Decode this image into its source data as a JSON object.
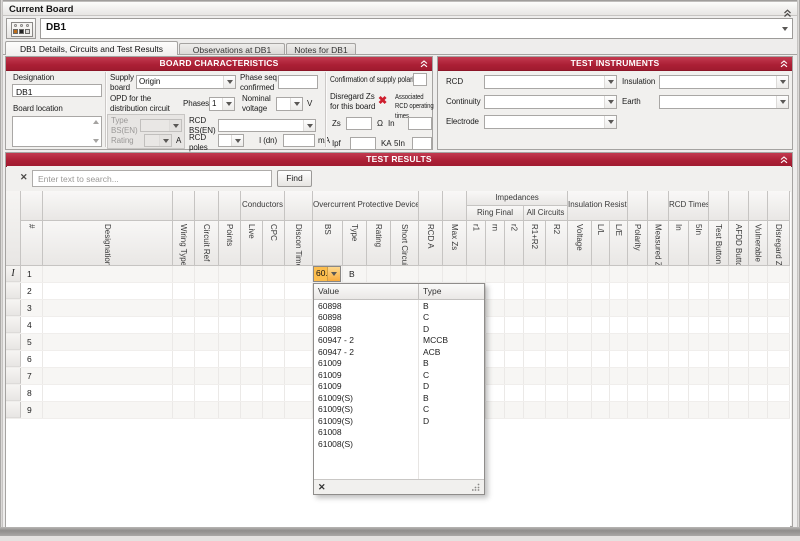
{
  "window": {
    "title": "Current Board",
    "board_value": "DB1"
  },
  "tabs": [
    "DB1 Details, Circuits and Test Results",
    "Observations at DB1",
    "Notes for DB1"
  ],
  "colors": {
    "header_red": "#ab1f35",
    "editor_highlight": "#fcbd4d"
  },
  "bc": {
    "title": "BOARD CHARACTERISTICS",
    "designation_label": "Designation",
    "designation_value": "DB1",
    "location_label": "Board location",
    "supply_label": "Supply board",
    "supply_value": "Origin",
    "phase_seq_label": "Phase seq confirmed",
    "opd_label": "OPD for the distribution circuit",
    "phases_label": "Phases",
    "phases_value": "1",
    "nominal_label": "Nominal voltage",
    "volt_unit": "V",
    "type_label": "Type BS(EN)",
    "rcd_bs_label": "RCD BS(EN)",
    "rating_label": "Rating",
    "amp_unit": "A",
    "poles_label": "RCD poles",
    "idn_label": "I (dn)",
    "ma_unit": "mA",
    "confirm_label": "Confirmation of supply polarity",
    "disregard_label": "Disregard Zs for this board",
    "assoc_label": "Associated RCD operating times",
    "zs_label": "Zs",
    "ohm_unit": "Ω",
    "in_label": "In",
    "ipf_label": "Ipf",
    "ka_unit": "KA",
    "in5_label": "5In"
  },
  "ti": {
    "title": "TEST INSTRUMENTS",
    "rcd": "RCD",
    "insulation": "Insulation",
    "continuity": "Continuity",
    "earth": "Earth",
    "electrode": "Electrode"
  },
  "tr": {
    "title": "TEST RESULTS",
    "search_placeholder": "Enter text to search...",
    "find": "Find",
    "grid": {
      "units": [
        {
          "cols": [
            "#"
          ]
        },
        {
          "cols": [
            "Designation"
          ]
        },
        {
          "cols": [
            "Wiring Type"
          ]
        },
        {
          "cols": [
            "Circuit Ref"
          ]
        },
        {
          "cols": [
            "Points"
          ]
        },
        {
          "group": "Conductors",
          "cols": [
            "Live",
            "CPC"
          ]
        },
        {
          "cols": [
            "Discon Time"
          ]
        },
        {
          "group": "Overcurrent Protective Device",
          "cols": [
            "BS",
            "Type",
            "Rating",
            "Short Circuit"
          ]
        },
        {
          "cols": [
            "RCD A"
          ]
        },
        {
          "cols": [
            "Max Zs"
          ]
        },
        {
          "group": "Impedances",
          "subs": [
            {
              "label": "Ring Final",
              "cols": [
                "r1",
                "rn",
                "r2"
              ]
            },
            {
              "label": "All Circuits",
              "cols": [
                "R1+R2",
                "R2"
              ]
            }
          ]
        },
        {
          "group": "Insulation Resistance",
          "cols": [
            "Voltage",
            "L/L",
            "L/E"
          ]
        },
        {
          "cols": [
            "Polarity"
          ]
        },
        {
          "cols": [
            "Measured Zs"
          ]
        },
        {
          "group": "RCD Times",
          "cols": [
            "In",
            "5In"
          ]
        },
        {
          "cols": [
            "Test Button"
          ]
        },
        {
          "cols": [
            "AFDD Button"
          ]
        },
        {
          "cols": [
            "Vulnerable"
          ]
        },
        {
          "cols": [
            "Disregard Zs"
          ]
        }
      ],
      "row_numbers": [
        "1",
        "2",
        "3",
        "4",
        "5",
        "6",
        "7",
        "8",
        "9"
      ],
      "editor": {
        "value": "60...",
        "type": "B"
      }
    }
  },
  "popup": {
    "headers": [
      "Value",
      "Type"
    ],
    "items": [
      {
        "value": "60898",
        "type": "B"
      },
      {
        "value": "60898",
        "type": "C"
      },
      {
        "value": "60898",
        "type": "D"
      },
      {
        "value": "60947 - 2",
        "type": "MCCB"
      },
      {
        "value": "60947 - 2",
        "type": "ACB"
      },
      {
        "value": "61009",
        "type": "B"
      },
      {
        "value": "61009",
        "type": "C"
      },
      {
        "value": "61009",
        "type": "D"
      },
      {
        "value": "61009(S)",
        "type": "B"
      },
      {
        "value": "61009(S)",
        "type": "C"
      },
      {
        "value": "61009(S)",
        "type": "D"
      },
      {
        "value": "61008",
        "type": ""
      },
      {
        "value": "61008(S)",
        "type": ""
      }
    ]
  }
}
